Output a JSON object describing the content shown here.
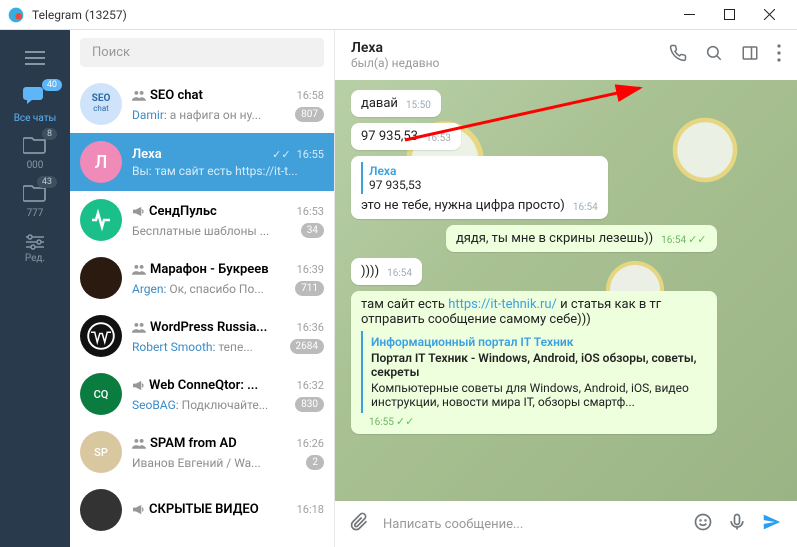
{
  "window": {
    "title": "Telegram (13257)"
  },
  "rail": {
    "all_chats_label": "Все чаты",
    "all_chats_badge": "40",
    "folder1_label": "000",
    "folder1_badge": "8",
    "folder2_label": "777",
    "folder2_badge": "43",
    "edit_label": "Ред."
  },
  "search": {
    "placeholder": "Поиск"
  },
  "chats": [
    {
      "name": "SEO chat",
      "time": "16:58",
      "sender": "Damir",
      "preview": "а нафига он ну...",
      "badge": "807",
      "avatar_bg": "#cfe4fa",
      "avatar_text": "SEO",
      "avatar_sub": "chat",
      "group": true
    },
    {
      "name": "Леха",
      "time": "16:55",
      "sender": "Вы",
      "preview": "там сайт есть https://it-t...",
      "checks": true,
      "avatar_bg": "#f08ab8",
      "avatar_text": "Л",
      "group": false,
      "selected": true
    },
    {
      "name": "СендПульс",
      "time": "16:53",
      "preview": "Бесплатные шаблоны ...",
      "badge": "34",
      "avatar_bg": "#1bbf89",
      "avatar_svg": "pulse",
      "group": false,
      "channel": true
    },
    {
      "name": "Марафон - Букреев",
      "time": "16:39",
      "sender": "Argen",
      "preview": "Ок, спасибо По...",
      "badge": "711",
      "avatar_bg": "#2b1a10",
      "avatar_img": "group1",
      "group": true
    },
    {
      "name": "WordPress Russia...",
      "time": "16:36",
      "sender": "Robert Smooth",
      "preview": "тепе...",
      "badge": "2684",
      "avatar_bg": "#111",
      "avatar_svg": "wp",
      "group": true
    },
    {
      "name": "Web ConneQtor: ...",
      "time": "16:32",
      "sender": "SeoBAG",
      "preview": "Подключайте...",
      "badge": "830",
      "avatar_bg": "#0a7c3f",
      "avatar_text": "CQ",
      "group": false,
      "channel": true
    },
    {
      "name": "SPAM from AD",
      "time": "16:26",
      "preview": "Иванов Евгений / Wa...",
      "badge": "2",
      "avatar_bg": "#d9c7a0",
      "avatar_text": "SP",
      "group": true
    },
    {
      "name": "СКРЫТЫЕ ВИДЕО",
      "time": "16:18",
      "preview": "",
      "avatar_bg": "#333",
      "group": false,
      "channel": true
    }
  ],
  "conversation": {
    "title": "Леха",
    "status": "был(а) недавно",
    "messages": [
      {
        "dir": "in",
        "text": "давай",
        "time": "15:50"
      },
      {
        "dir": "in",
        "text": "97 935,53",
        "time": "16:53"
      },
      {
        "dir": "in",
        "reply": {
          "name": "Леха",
          "text": "97 935,53"
        },
        "text": "это не тебе, нужна цифра просто)",
        "time": "16:54"
      },
      {
        "dir": "out",
        "text": "дядя, ты мне в скрины лезешь))",
        "time": "16:54",
        "checks": true
      },
      {
        "dir": "in",
        "text": "))))",
        "time": "16:54"
      },
      {
        "dir": "out",
        "text_pre": "там сайт есть ",
        "link": "https://it-tehnik.ru/",
        "text_post": " и статья как в тг отправить сообщение самому себе)))",
        "card": {
          "title": "Информационный портал IT Техник",
          "sub": "Портал IT Техник - Windows, Android, iOS обзоры, советы, секреты",
          "desc": "Компьютерные советы для Windows, Android, iOS, видео инструкции, новости мира IT, обзоры смартф..."
        },
        "time": "16:55",
        "checks": true
      }
    ]
  },
  "compose": {
    "placeholder": "Написать сообщение..."
  }
}
